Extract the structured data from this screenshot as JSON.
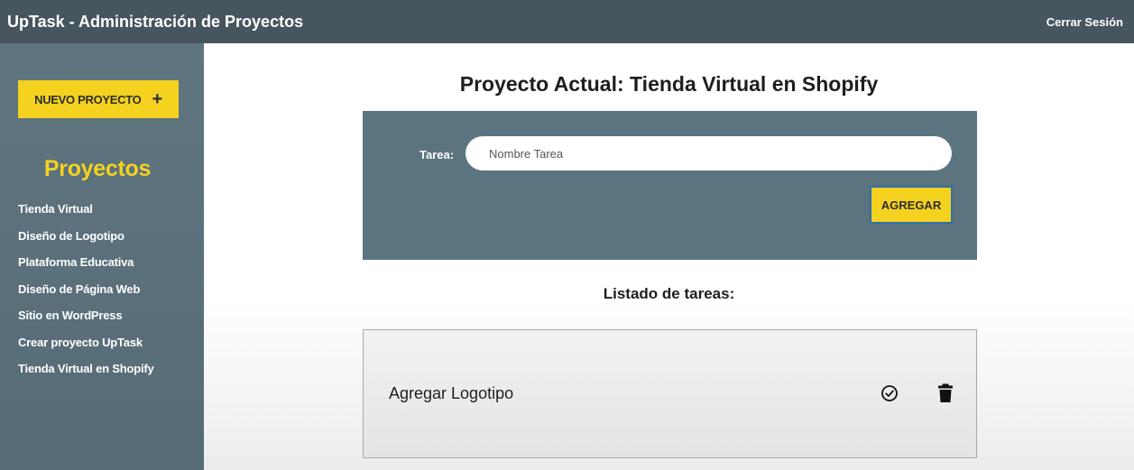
{
  "header": {
    "title": "UpTask - Administración de Proyectos",
    "logout_label": "Cerrar Sesión"
  },
  "sidebar": {
    "new_project_label": "NUEVO PROYECTO",
    "new_project_icon": "+",
    "heading": "Proyectos",
    "projects": [
      "Tienda Virtual",
      "Diseño de Logotipo",
      "Plataforma Educativa",
      "Diseño de Página Web",
      "Sitio en WordPress",
      "Crear proyecto UpTask",
      "Tienda Virtual en Shopify"
    ]
  },
  "main": {
    "title_label": "Proyecto Actual:",
    "title_value": "Tienda Virtual en Shopify",
    "form": {
      "task_label": "Tarea:",
      "task_placeholder": "Nombre Tarea",
      "submit_label": "AGREGAR"
    },
    "list_heading": "Listado de tareas:",
    "tasks": [
      {
        "name": "Agregar Logotipo"
      }
    ]
  },
  "colors": {
    "topbar": "#46555e",
    "sidebar": "#5f7580",
    "accent": "#f4d21f",
    "panel": "#5b7480"
  }
}
